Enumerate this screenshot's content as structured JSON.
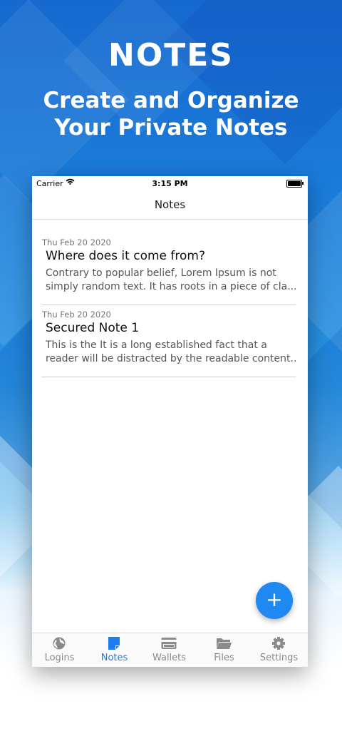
{
  "promo": {
    "title": "NOTES",
    "subtitle_line1": "Create and Organize",
    "subtitle_line2": "Your Private Notes"
  },
  "status_bar": {
    "carrier": "Carrier",
    "time": "3:15 PM"
  },
  "nav": {
    "title": "Notes"
  },
  "notes": [
    {
      "date": "Thu Feb 20 2020",
      "title": "Where does it come from?",
      "preview_line1": "Contrary to popular belief, Lorem Ipsum is not",
      "preview_line2": "simply random text. It has roots in a piece of cla..."
    },
    {
      "date": "Thu Feb 20 2020",
      "title": "Secured Note 1",
      "preview_line1": "This is the It is a long established fact that a",
      "preview_line2": "reader will be distracted by the readable content..."
    }
  ],
  "fab": {
    "label": "+",
    "icon": "plus-icon"
  },
  "tabs": [
    {
      "label": "Logins",
      "icon": "globe-icon",
      "active": false
    },
    {
      "label": "Notes",
      "icon": "note-icon",
      "active": true
    },
    {
      "label": "Wallets",
      "icon": "card-icon",
      "active": false
    },
    {
      "label": "Files",
      "icon": "folder-icon",
      "active": false
    },
    {
      "label": "Settings",
      "icon": "gear-icon",
      "active": false
    }
  ],
  "colors": {
    "accent": "#1f7cf0",
    "fab": "#1f88f1",
    "inactive_tab": "#8a8a8a"
  }
}
